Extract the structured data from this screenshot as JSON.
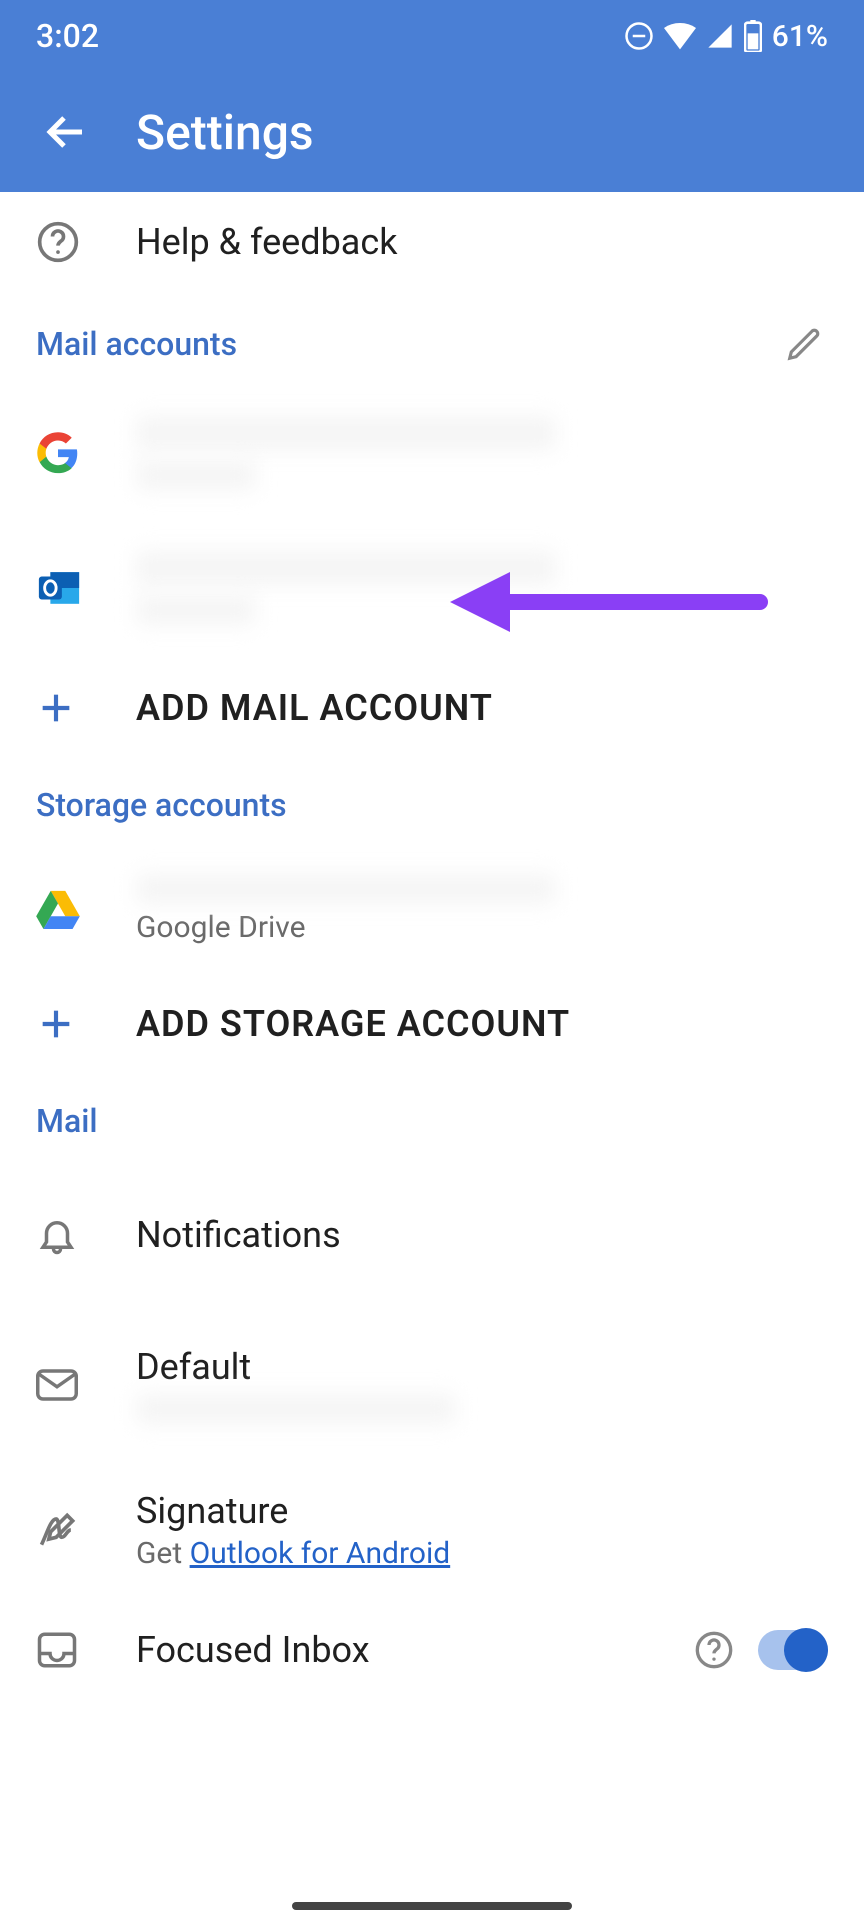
{
  "status": {
    "time": "3:02",
    "battery_pct": "61%"
  },
  "header": {
    "title": "Settings"
  },
  "help_feedback": {
    "label": "Help & feedback"
  },
  "sections": {
    "mail_accounts": {
      "label": "Mail accounts"
    },
    "storage_accounts": {
      "label": "Storage accounts"
    },
    "mail": {
      "label": "Mail"
    }
  },
  "actions": {
    "add_mail": "ADD MAIL ACCOUNT",
    "add_storage": "ADD STORAGE ACCOUNT"
  },
  "storage": {
    "gdrive": {
      "subtitle": "Google Drive"
    }
  },
  "mail_settings": {
    "notifications": "Notifications",
    "default": "Default",
    "signature": {
      "title": "Signature",
      "prefix": "Get ",
      "link": "Outlook for Android"
    },
    "focused": "Focused Inbox"
  },
  "colors": {
    "accent": "#4a7fd5",
    "link": "#2362c8",
    "arrow": "#8a3ff5"
  }
}
